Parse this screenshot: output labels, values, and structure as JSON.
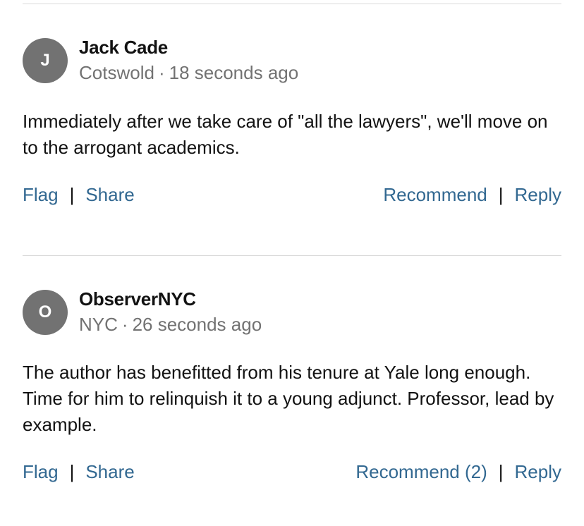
{
  "comments": [
    {
      "avatar_initial": "J",
      "author": "Jack Cade",
      "location": "Cotswold",
      "time": "18 seconds ago",
      "body": "Immediately after we take care of \"all the lawyers\", we'll move on to the arrogant academics.",
      "actions": {
        "flag": "Flag",
        "share": "Share",
        "recommend": "Recommend",
        "reply": "Reply"
      }
    },
    {
      "avatar_initial": "O",
      "author": "ObserverNYC",
      "location": "NYC",
      "time": "26 seconds ago",
      "body": "The author has benefitted from his tenure at Yale long enough. Time for him to relinquish it to a young adjunct. Professor, lead by example.",
      "actions": {
        "flag": "Flag",
        "share": "Share",
        "recommend": "Recommend (2)",
        "reply": "Reply"
      }
    }
  ],
  "separators": {
    "pipe": "|",
    "dot": "·"
  },
  "colors": {
    "link": "#326891",
    "avatar_bg": "#727272",
    "meta_text": "#727272",
    "divider": "#d9d9d9"
  }
}
